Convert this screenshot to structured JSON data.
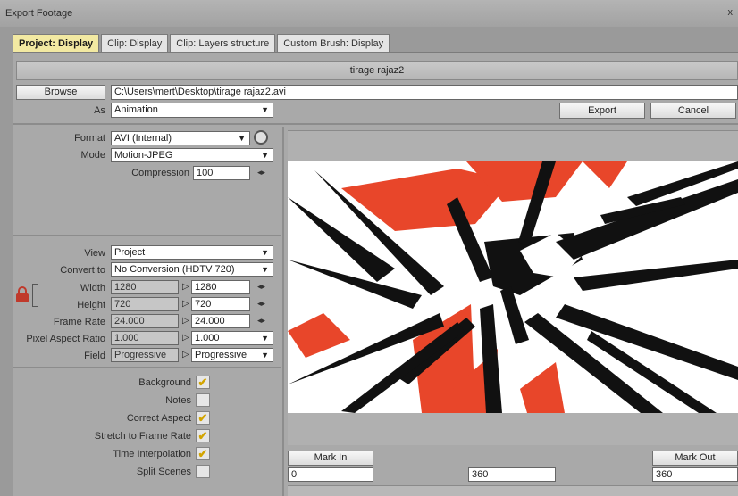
{
  "window": {
    "title": "Export Footage",
    "close": "x"
  },
  "tabs": [
    "Project: Display",
    "Clip: Display",
    "Clip: Layers structure",
    "Custom Brush: Display"
  ],
  "name_bar": "tirage rajaz2",
  "browse": {
    "button": "Browse",
    "path": "C:\\Users\\mert\\Desktop\\tirage rajaz2.avi"
  },
  "as": {
    "label": "As",
    "value": "Animation"
  },
  "actions": {
    "export": "Export",
    "cancel": "Cancel"
  },
  "format": {
    "label": "Format",
    "value": "AVI (Internal)"
  },
  "mode": {
    "label": "Mode",
    "value": "Motion-JPEG"
  },
  "compression": {
    "label": "Compression",
    "value": "100"
  },
  "view": {
    "label": "View",
    "value": "Project"
  },
  "convert_to": {
    "label": "Convert to",
    "value": "No Conversion (HDTV 720)"
  },
  "width": {
    "label": "Width",
    "source": "1280",
    "target": "1280"
  },
  "height": {
    "label": "Height",
    "source": "720",
    "target": "720"
  },
  "frame_rate": {
    "label": "Frame Rate",
    "source": "24.000",
    "target": "24.000"
  },
  "pixel_aspect": {
    "label": "Pixel Aspect Ratio",
    "source": "1.000",
    "target": "1.000"
  },
  "field": {
    "label": "Field",
    "source": "Progressive",
    "target": "Progressive"
  },
  "options": [
    {
      "label": "Background",
      "checked": true
    },
    {
      "label": "Notes",
      "checked": false
    },
    {
      "label": "Correct Aspect",
      "checked": true
    },
    {
      "label": "Stretch to Frame Rate",
      "checked": true
    },
    {
      "label": "Time Interpolation",
      "checked": true
    },
    {
      "label": "Split Scenes",
      "checked": false
    }
  ],
  "timeline": {
    "mark_in": "Mark In",
    "mark_out": "Mark Out",
    "in_value": "0",
    "mid_value": "360",
    "out_value": "360"
  },
  "icons": {
    "lock": "lock-icon",
    "dropdown": "chevron-down-icon",
    "settings": "settings-icon",
    "link": "link-arrows-icon",
    "arrow": "arrow-right-icon",
    "check": "checkmark-icon"
  },
  "colors": {
    "accent_tab": "#f2e9a2",
    "check": "#d2a400",
    "lock": "#c0392b",
    "art_red": "#e8462a"
  }
}
